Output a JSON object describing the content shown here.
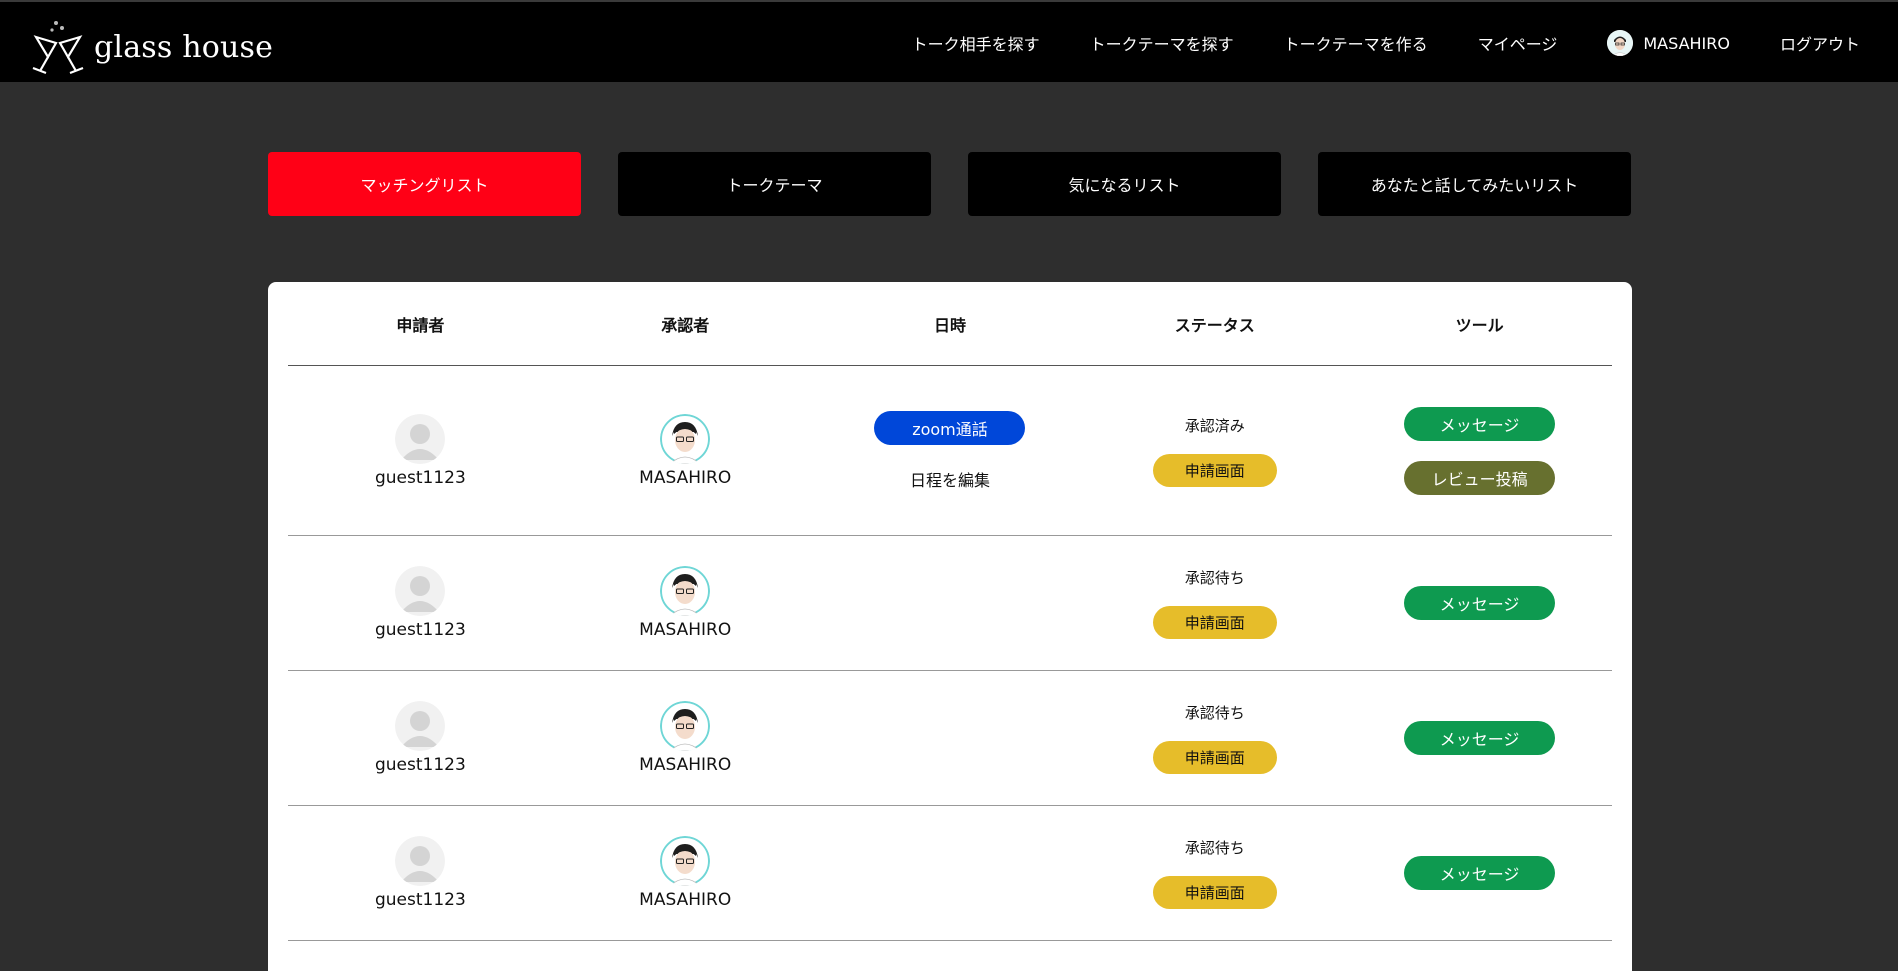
{
  "header": {
    "logo_text": "glass house",
    "nav": [
      {
        "label": "トーク相手を探す"
      },
      {
        "label": "トークテーマを探す"
      },
      {
        "label": "トークテーマを作る"
      },
      {
        "label": "マイページ"
      },
      {
        "label": "MASAHIRO"
      },
      {
        "label": "ログアウト"
      }
    ]
  },
  "tabs": [
    {
      "label": "マッチングリスト",
      "active": true
    },
    {
      "label": "トークテーマ",
      "active": false
    },
    {
      "label": "気になるリスト",
      "active": false
    },
    {
      "label": "あなたと話してみたいリスト",
      "active": false
    }
  ],
  "table": {
    "headers": [
      "申請者",
      "承認者",
      "日時",
      "ステータス",
      "ツール"
    ],
    "rows": [
      {
        "applicant": "guest1123",
        "approver": "MASAHIRO",
        "zoom_label": "zoom通話",
        "edit_label": "日程を編集",
        "status": "承認済み",
        "apply_label": "申請画面",
        "message_label": "メッセージ",
        "review_label": "レビュー投稿"
      },
      {
        "applicant": "guest1123",
        "approver": "MASAHIRO",
        "status": "承認待ち",
        "apply_label": "申請画面",
        "message_label": "メッセージ"
      },
      {
        "applicant": "guest1123",
        "approver": "MASAHIRO",
        "status": "承認待ち",
        "apply_label": "申請画面",
        "message_label": "メッセージ"
      },
      {
        "applicant": "guest1123",
        "approver": "MASAHIRO",
        "status": "承認待ち",
        "apply_label": "申請画面",
        "message_label": "メッセージ"
      }
    ]
  },
  "colors": {
    "active_tab": "#ff0016",
    "zoom_button": "#0047d9",
    "apply_button": "#e6bd2a",
    "message_button": "#0e9a50",
    "review_button": "#67702f"
  }
}
